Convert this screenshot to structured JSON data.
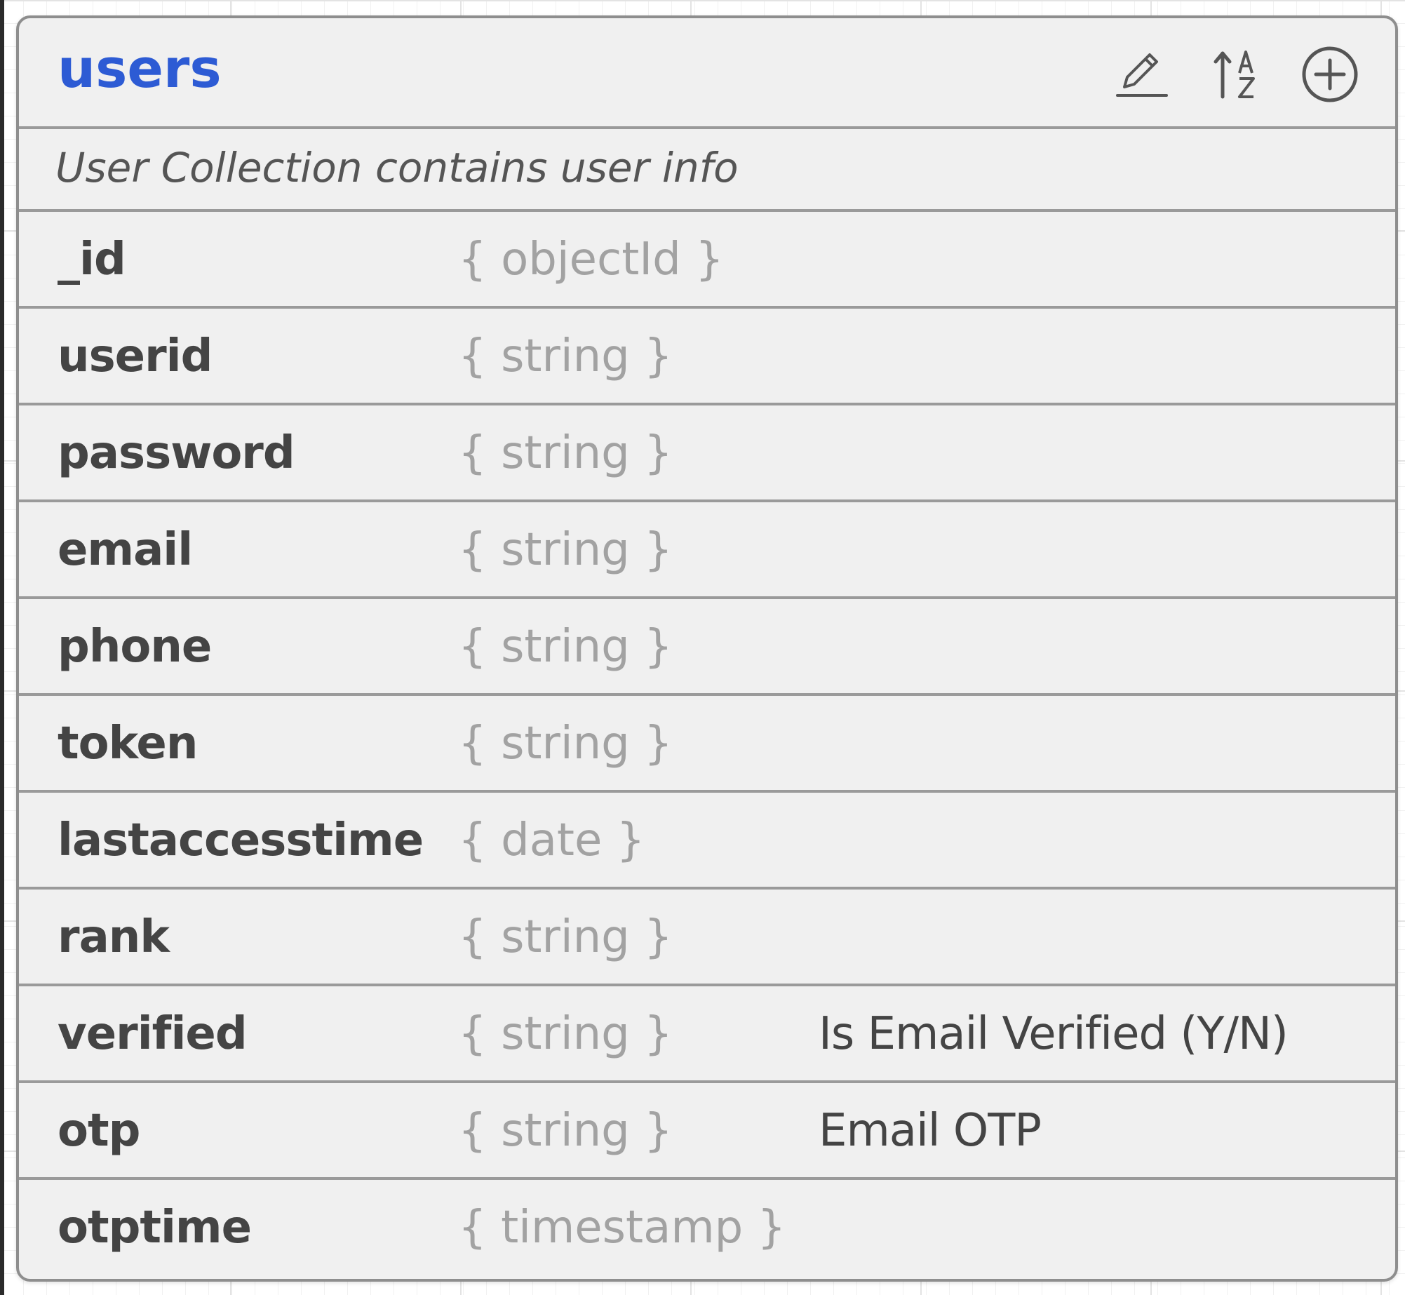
{
  "collection": {
    "name": "users",
    "description": "User Collection contains user info"
  },
  "actions": {
    "edit_icon": "pencil-icon",
    "sort_icon": "sort-alpha-icon",
    "add_icon": "plus-circle-icon"
  },
  "colors": {
    "title": "#2d5bd4",
    "field_name": "#444444",
    "field_type": "#a2a2a2",
    "card_background": "#f0f0f0",
    "border": "#9a9a9a"
  },
  "fields": [
    {
      "name": "_id",
      "type": "{ objectId }",
      "description": ""
    },
    {
      "name": "userid",
      "type": "{ string }",
      "description": ""
    },
    {
      "name": "password",
      "type": "{ string }",
      "description": ""
    },
    {
      "name": "email",
      "type": "{ string }",
      "description": ""
    },
    {
      "name": "phone",
      "type": "{ string }",
      "description": ""
    },
    {
      "name": "token",
      "type": "{ string }",
      "description": ""
    },
    {
      "name": "lastaccesstime",
      "type": "{ date }",
      "description": ""
    },
    {
      "name": "rank",
      "type": "{ string }",
      "description": ""
    },
    {
      "name": "verified",
      "type": "{ string }",
      "description": "Is Email Verified (Y/N)"
    },
    {
      "name": "otp",
      "type": "{ string }",
      "description": "Email OTP"
    },
    {
      "name": "otptime",
      "type": "{ timestamp }",
      "description": ""
    }
  ]
}
